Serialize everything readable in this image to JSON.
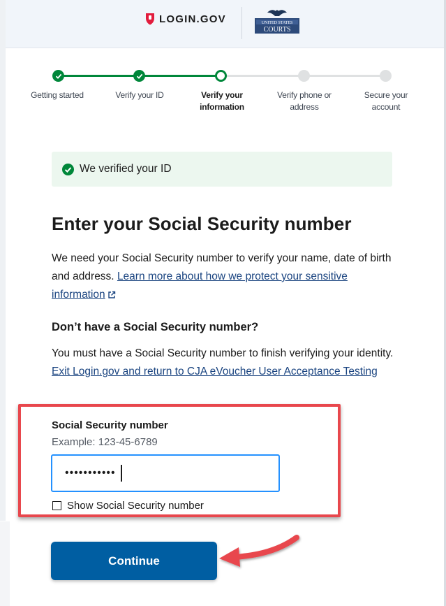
{
  "header": {
    "brand_name": "LOGIN.GOV",
    "partner_logo_line1": "UNITED STATES",
    "partner_logo_line2": "COURTS"
  },
  "steps": [
    {
      "label": "Getting started",
      "status": "complete"
    },
    {
      "label": "Verify your ID",
      "status": "complete"
    },
    {
      "label": "Verify your information",
      "status": "current"
    },
    {
      "label": "Verify phone or address",
      "status": "incomplete"
    },
    {
      "label": "Secure your account",
      "status": "incomplete"
    }
  ],
  "alert": {
    "text": "We verified your ID"
  },
  "page_title": "Enter your Social Security number",
  "intro": {
    "text": "We need your Social Security number to verify your name, date of birth and address. ",
    "link": "Learn more about how we protect your sensitive information"
  },
  "no_ssn": {
    "heading": "Don’t have a Social Security number?",
    "text": "You must have a Social Security number to finish verifying your identity. ",
    "link": "Exit Login.gov and return to CJA eVoucher User Acceptance Testing"
  },
  "ssn_field": {
    "label": "Social Security number",
    "hint": "Example: 123-45-6789",
    "value": "•••••••••••"
  },
  "show_ssn": {
    "label": "Show Social Security number",
    "checked": false
  },
  "continue_label": "Continue",
  "colors": {
    "success": "#00873a",
    "primary": "#005ea2",
    "link": "#1a4480",
    "annotation": "#e8474d",
    "alert_bg": "#ecf7ef"
  }
}
